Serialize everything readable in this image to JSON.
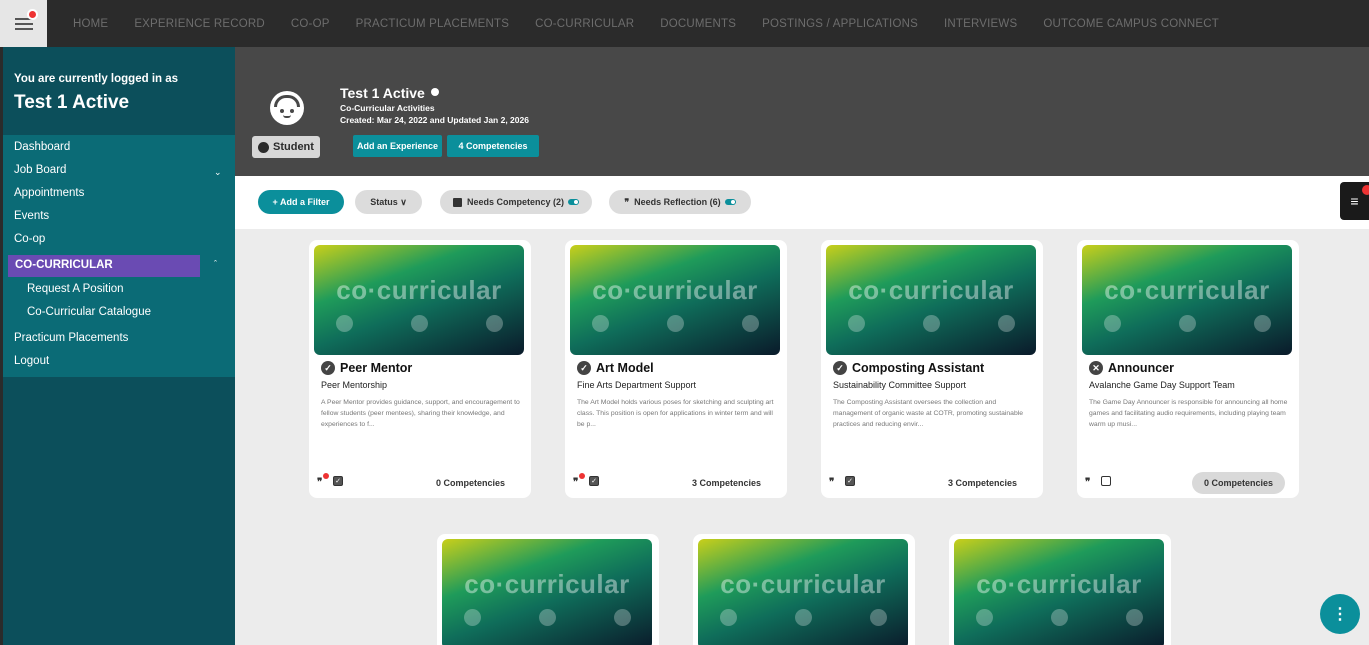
{
  "topnav": {
    "links": [
      "HOME",
      "EXPERIENCE RECORD",
      "CO-OP",
      "PRACTICUM PLACEMENTS",
      "CO-CURRICULAR",
      "DOCUMENTS",
      "POSTINGS / APPLICATIONS",
      "INTERVIEWS",
      "OUTCOME CAMPUS CONNECT"
    ]
  },
  "sidebar": {
    "logged_label": "You are currently logged in as",
    "user_name": "Test 1 Active",
    "items": {
      "dashboard": "Dashboard",
      "job_board": "Job Board",
      "appointments": "Appointments",
      "events": "Events",
      "coop": "Co-op",
      "cocurricular": "CO-CURRICULAR",
      "request": "Request A Position",
      "catalogue": "Co-Curricular Catalogue",
      "practicum": "Practicum Placements",
      "logout": "Logout"
    }
  },
  "header": {
    "title": "Test 1 Active",
    "subtitle": "Co-Curricular Activities",
    "created": "Created: Mar 24, 2022 and Updated Jan 2, 2026",
    "badge": "Student",
    "add_experience": "Add an Experience",
    "competencies": "4 Competencies"
  },
  "filters": {
    "add_filter": "+ Add a Filter",
    "status": "Status ∨",
    "needs_competency": "Needs Competency (2)",
    "needs_reflection": "Needs Reflection (6)"
  },
  "banner_word": "co·curricular",
  "cards": [
    {
      "title": "Peer Mentor",
      "status": "approved",
      "sub": "Peer Mentorship",
      "desc": "A Peer Mentor provides guidance, support, and encouragement to fellow students (peer mentees), sharing their knowledge, and experiences to f...",
      "competencies": "0 Competencies"
    },
    {
      "title": "Art Model",
      "status": "approved",
      "sub": "Fine Arts Department Support",
      "desc": "The Art Model holds various poses for sketching and sculpting art class. This position is open for applications in winter term and will be p...",
      "competencies": "3 Competencies"
    },
    {
      "title": "Composting Assistant",
      "status": "approved",
      "sub": "Sustainability Committee Support",
      "desc": "The Composting Assistant oversees the collection and management of organic waste at COTR, promoting sustainable practices and reducing envir...",
      "competencies": "3 Competencies"
    },
    {
      "title": "Announcer",
      "status": "declined",
      "sub": "Avalanche Game Day Support Team",
      "desc": "The Game Day Announcer is responsible for announcing all home games and facilitating audio requirements, including playing team warm up musi...",
      "competencies": "0 Competencies"
    }
  ],
  "colors": {
    "sidebar": "#0c4f5b",
    "accent_teal": "#0b8f9b",
    "active_purple": "#6a4bb3",
    "header": "#484848"
  }
}
